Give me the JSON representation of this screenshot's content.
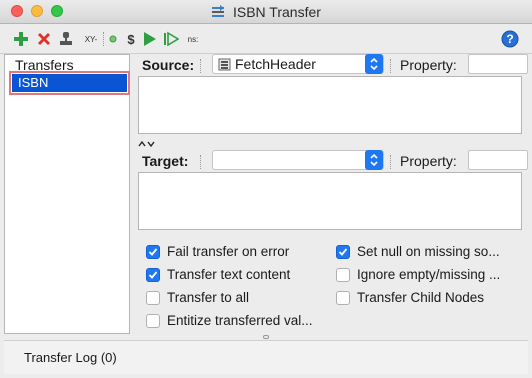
{
  "window": {
    "title": "ISBN Transfer"
  },
  "toolbar": {
    "xy_label": "XY-",
    "dollar_label": "$",
    "ns_label": "ns:"
  },
  "left": {
    "header": "Transfers",
    "items": [
      {
        "label": "ISBN",
        "selected": true
      }
    ]
  },
  "source": {
    "label": "Source:",
    "value": "FetchHeader",
    "property_label": "Property:",
    "property_value": ""
  },
  "target": {
    "label": "Target:",
    "value": "",
    "property_label": "Property:",
    "property_value": ""
  },
  "options": [
    {
      "label": "Fail transfer on error",
      "checked": true
    },
    {
      "label": "Set null on missing so...",
      "checked": true
    },
    {
      "label": "Transfer text content",
      "checked": true
    },
    {
      "label": "Ignore empty/missing ...",
      "checked": false
    },
    {
      "label": "Transfer to all",
      "checked": false
    },
    {
      "label": "Transfer Child Nodes",
      "checked": false
    },
    {
      "label": "Entitize transferred val...",
      "checked": false
    }
  ],
  "log": {
    "label": "Transfer Log (0)"
  },
  "colors": {
    "accent": "#1f78f2",
    "selection": "#0a55d4",
    "highlight_outline": "#e07a7a",
    "add_green": "#2ea043",
    "delete_red": "#e0302b"
  },
  "icons": {
    "title": "transfer-icon",
    "add": "add-icon",
    "delete": "delete-icon",
    "stamp": "stamp-icon",
    "run": "play-icon",
    "step": "step-icon",
    "help": "help-icon",
    "dropdown": "chevron-updown-icon",
    "datasource": "datasource-icon"
  }
}
